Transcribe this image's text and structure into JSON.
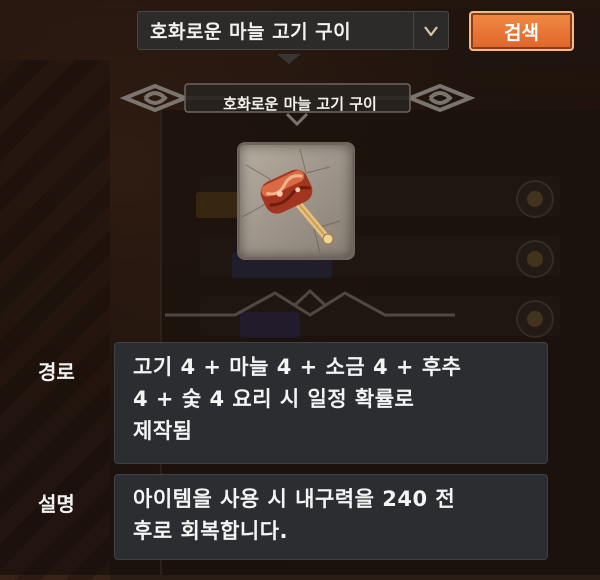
{
  "search": {
    "selected_value": "호화로운 마늘 고기 구이",
    "button_label": "검색"
  },
  "item": {
    "name": "호화로운 마늘 고기 구이",
    "icon": "grilled-meat-icon"
  },
  "details": {
    "route_label": "경로",
    "route_text": "고기 4 + 마늘 4 + 소금 4 + 후추\n4 + 숯 4 요리 시 일정 확률로\n제작됨",
    "desc_label": "설명",
    "desc_text": "아이템을 사용 시 내구력을 240 전\n후로 회복합니다."
  },
  "colors": {
    "search_button": "#e8703a",
    "panel": "#2b2d30",
    "text": "#f4f4f4"
  }
}
